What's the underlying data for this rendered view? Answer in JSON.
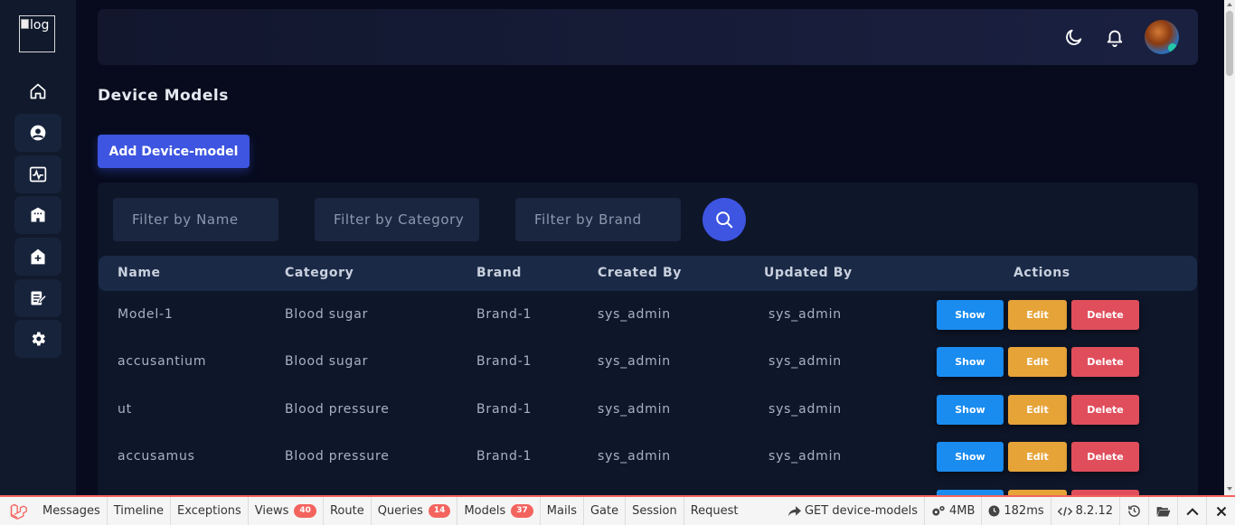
{
  "logo": {
    "alt_text": "log"
  },
  "sidebar": {
    "items": [
      {
        "icon": "home-icon"
      },
      {
        "icon": "user-circle-icon"
      },
      {
        "icon": "monitor-pulse-icon"
      },
      {
        "icon": "building-icon"
      },
      {
        "icon": "medical-house-icon"
      },
      {
        "icon": "clipboard-edit-icon"
      },
      {
        "icon": "gear-icon"
      }
    ]
  },
  "topbar": {
    "theme_icon": "moon-icon",
    "notification_icon": "bell-icon",
    "avatar": "user-avatar"
  },
  "page": {
    "title": "Device Models",
    "add_button": "Add Device-model"
  },
  "filters": {
    "name_placeholder": "Filter by Name",
    "category_placeholder": "Filter by Category",
    "brand_placeholder": "Filter by Brand",
    "search_icon": "search-icon"
  },
  "table": {
    "headers": {
      "name": "Name",
      "category": "Category",
      "brand": "Brand",
      "created_by": "Created By",
      "updated_by": "Updated By",
      "actions": "Actions"
    },
    "actions": {
      "show": "Show",
      "edit": "Edit",
      "delete": "Delete"
    },
    "rows": [
      {
        "name": "Model-1",
        "category": "Blood sugar",
        "brand": "Brand-1",
        "created_by": "sys_admin",
        "updated_by": "sys_admin"
      },
      {
        "name": "accusantium",
        "category": "Blood sugar",
        "brand": "Brand-1",
        "created_by": "sys_admin",
        "updated_by": "sys_admin"
      },
      {
        "name": "ut",
        "category": "Blood pressure",
        "brand": "Brand-1",
        "created_by": "sys_admin",
        "updated_by": "sys_admin"
      },
      {
        "name": "accusamus",
        "category": "Blood pressure",
        "brand": "Brand-1",
        "created_by": "sys_admin",
        "updated_by": "sys_admin"
      }
    ]
  },
  "debugbar": {
    "tabs": {
      "messages": "Messages",
      "timeline": "Timeline",
      "exceptions": "Exceptions",
      "views": "Views",
      "views_count": "40",
      "route": "Route",
      "queries": "Queries",
      "queries_count": "14",
      "models": "Models",
      "models_count": "37",
      "mails": "Mails",
      "gate": "Gate",
      "session": "Session",
      "request": "Request"
    },
    "indicators": {
      "request": "GET device-models",
      "memory": "4MB",
      "time": "182ms",
      "php_version": "8.2.12"
    },
    "accent_color": "#f4645f"
  },
  "colors": {
    "primary": "#3d55e0",
    "show": "#1a8cf0",
    "edit": "#e6a338",
    "delete": "#e04e5c"
  }
}
